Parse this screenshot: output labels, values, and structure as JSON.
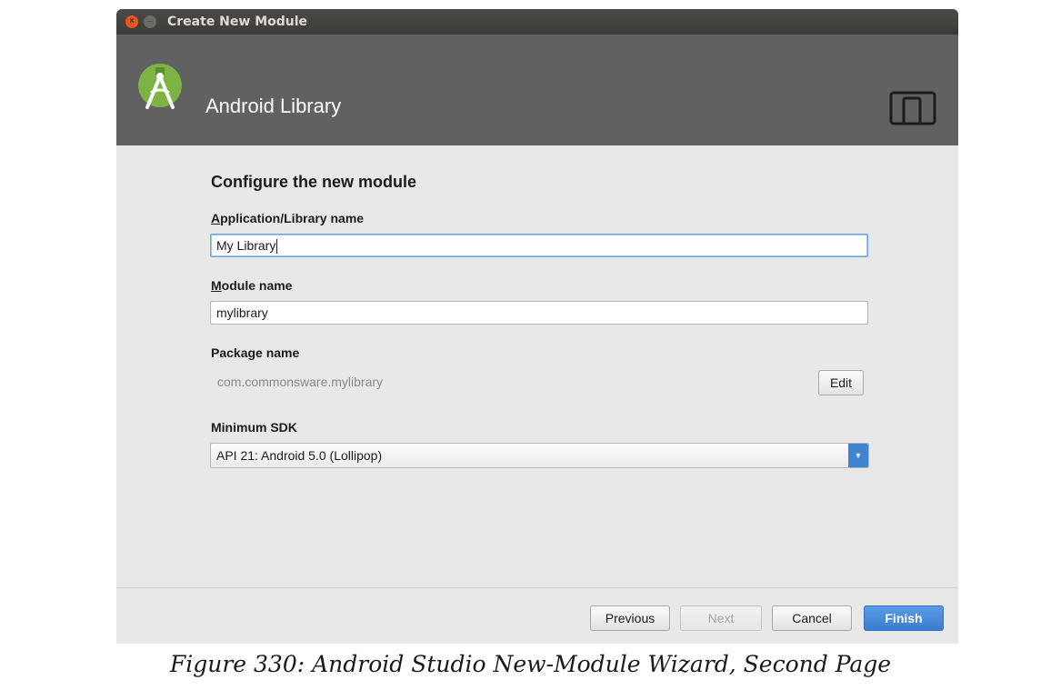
{
  "window": {
    "title": "Create New Module"
  },
  "header": {
    "title": "Android Library",
    "logo_icon": "android-studio-logo-icon",
    "device_icon": "tablet-phone-icon"
  },
  "form": {
    "section_title": "Configure the new module",
    "app_name_label_mnemonic": "A",
    "app_name_label_rest": "pplication/Library name",
    "app_name_value": "My Library",
    "module_name_label_mnemonic": "M",
    "module_name_label_rest": "odule name",
    "module_name_value": "mylibrary",
    "package_name_label": "Package name",
    "package_name_value": "com.commonsware.mylibrary",
    "edit_button": "Edit",
    "min_sdk_label": "Minimum SDK",
    "min_sdk_value": "API 21: Android 5.0 (Lollipop)"
  },
  "footer": {
    "previous": "Previous",
    "next": "Next",
    "cancel": "Cancel",
    "finish": "Finish"
  },
  "caption": "Figure 330: Android Studio New-Module Wizard, Second Page",
  "colors": {
    "header_bg": "#616161",
    "accent": "#3f83d1",
    "android_green": "#7cb342"
  }
}
